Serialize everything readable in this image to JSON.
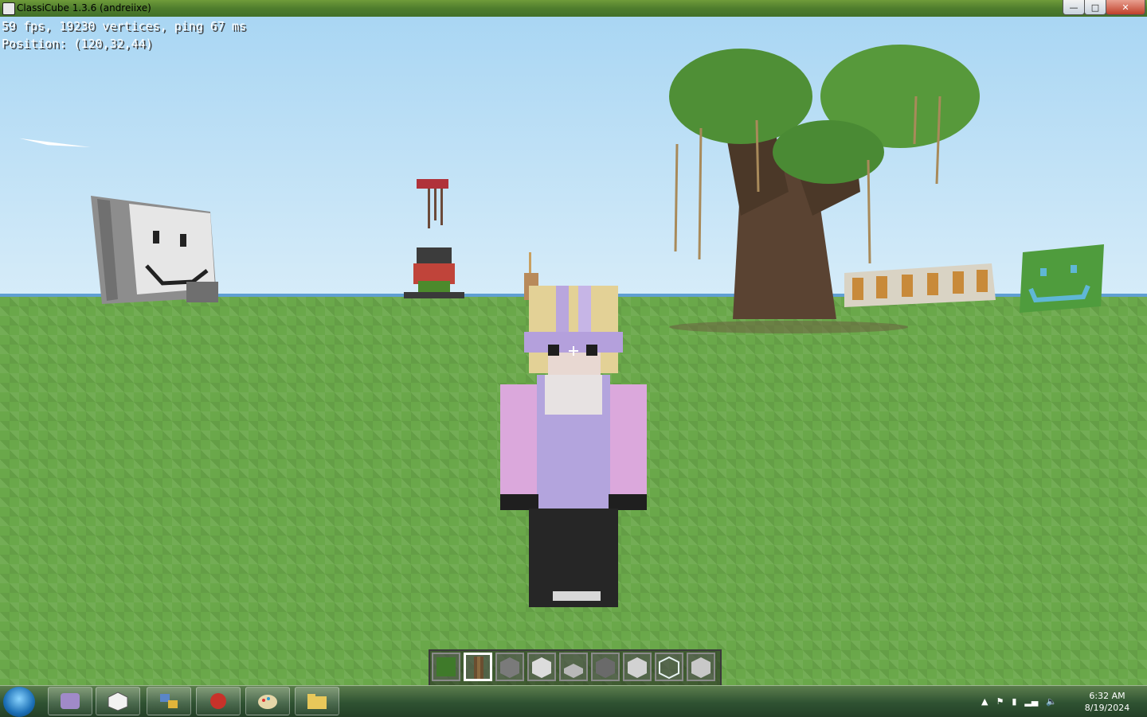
{
  "window": {
    "title": "ClassiCube 1.3.6 (andreiixe)",
    "minimize_label": "—",
    "maximize_label": "□",
    "close_label": "✕"
  },
  "hud": {
    "stats": "59 fps, 19230 vertices, ping 67 ms",
    "position": "Position: (120,32,44)"
  },
  "hotbar": {
    "selected_index": 1,
    "slots": [
      "leaves",
      "log",
      "stone",
      "stone-slab",
      "slab",
      "gravel",
      "stone",
      "glass",
      "stone"
    ]
  },
  "taskbar": {
    "buttons": [
      "media-player-icon",
      "classicube-icon",
      "network-manager-icon",
      "browser-icon",
      "paint-icon",
      "file-explorer-icon"
    ]
  },
  "clock": {
    "time": "6:32 AM",
    "date": "8/19/2024"
  },
  "colors": {
    "sky": "#a9d6f3",
    "grass": "#6aa84a",
    "taskbar": "#2f5232"
  }
}
